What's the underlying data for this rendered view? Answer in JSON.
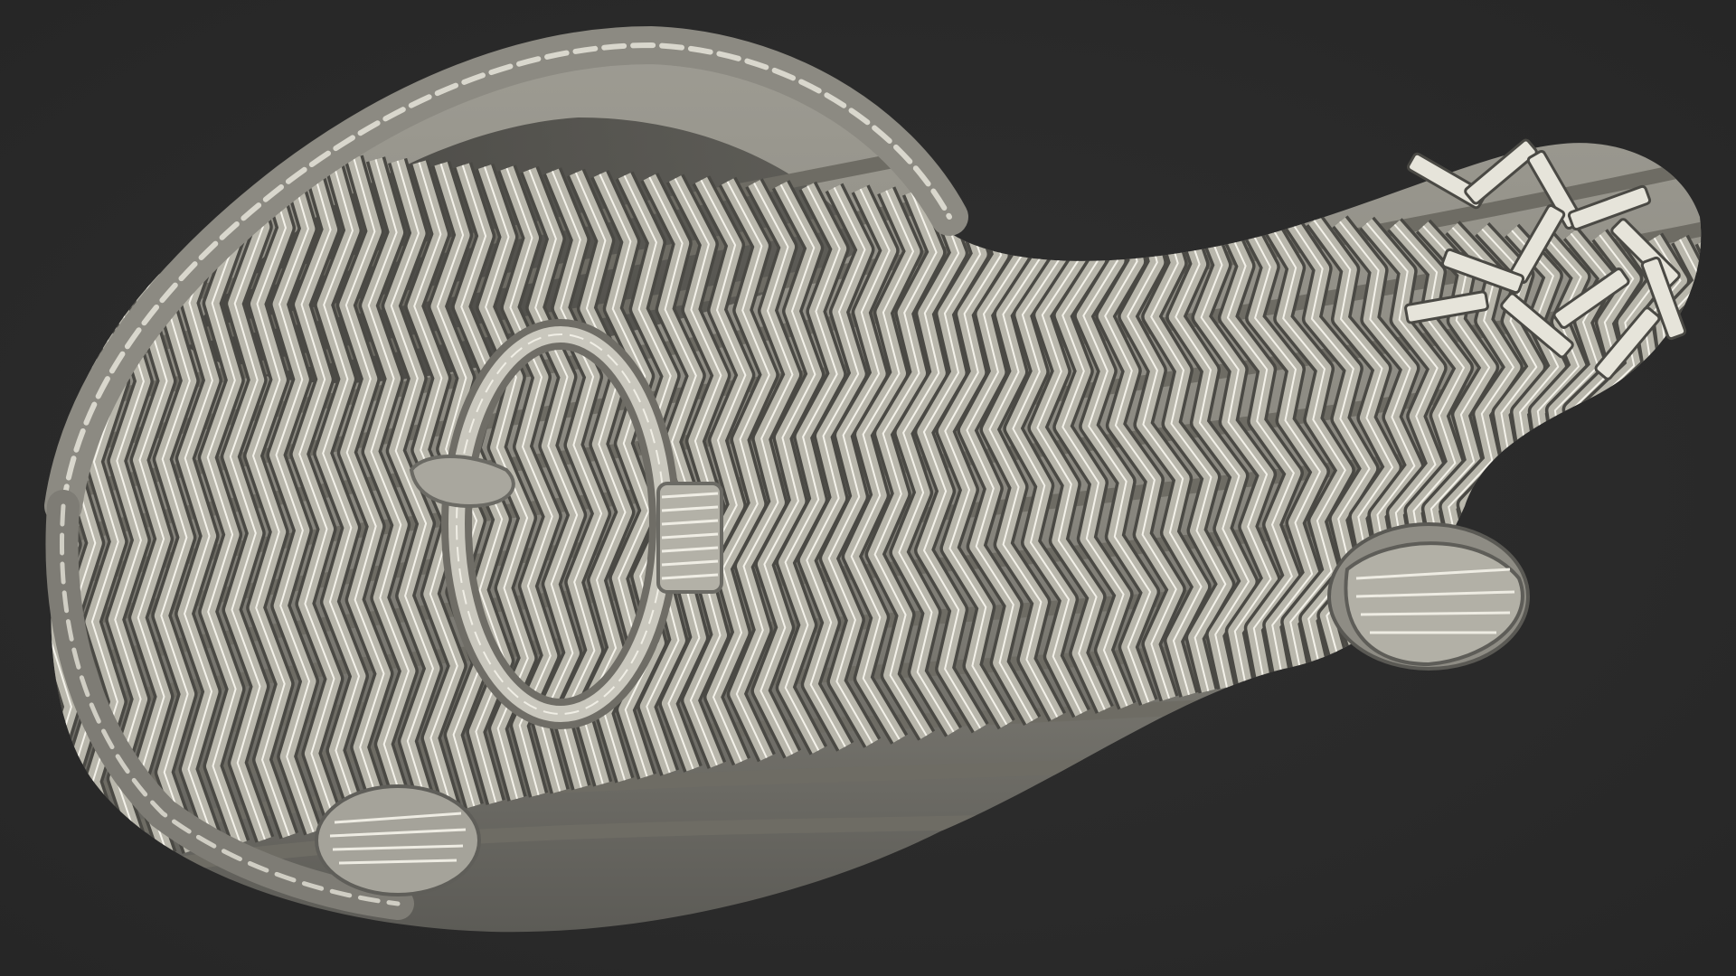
{
  "scene": {
    "background_color": "#2b2b2b",
    "subject": "wicker-cornucopia-basket-wireframe",
    "material_colors": {
      "wicker_base": "#b9b7ac",
      "wicker_light": "#e6e4da",
      "wicker_dark": "#6e6c64",
      "wire_edge": "#f4f2ea",
      "shadow": "#4a4944"
    }
  }
}
